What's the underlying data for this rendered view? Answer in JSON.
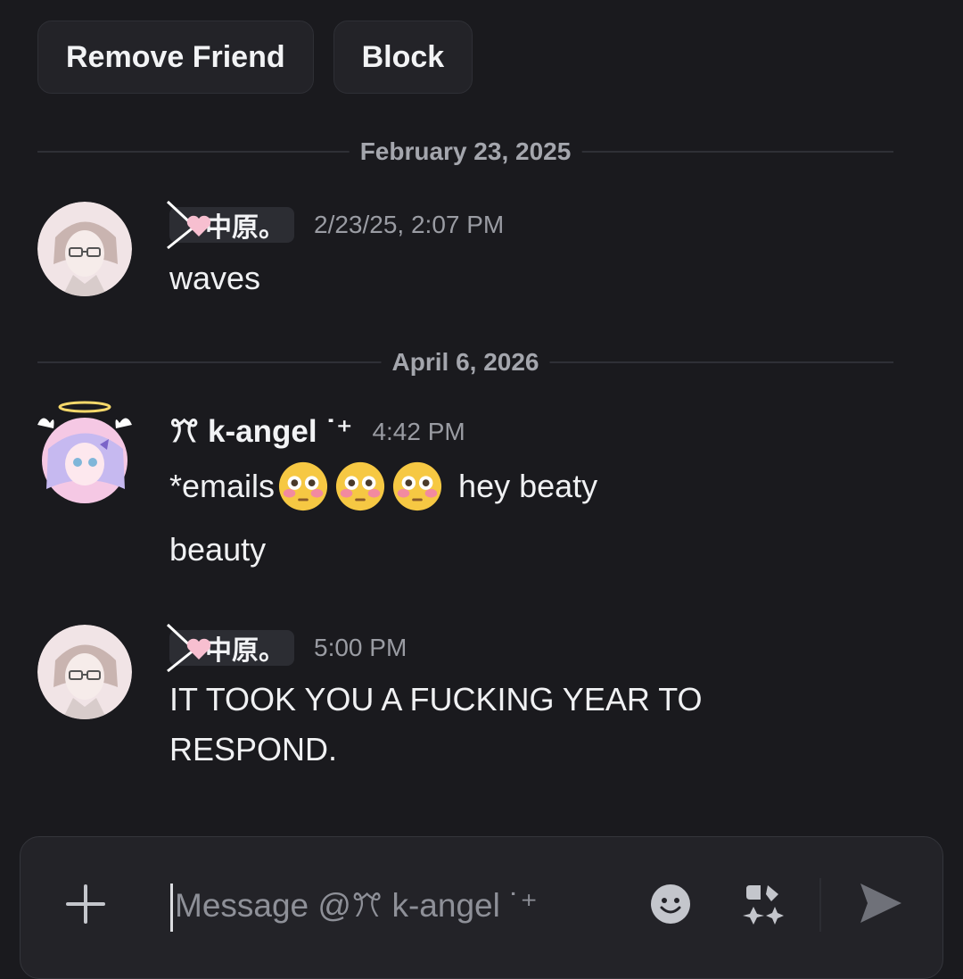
{
  "actions": {
    "remove_friend": "Remove Friend",
    "block": "Block"
  },
  "dividers": [
    "February 23, 2025",
    "April 6, 2026"
  ],
  "messages": [
    {
      "author": "中原。",
      "timestamp": "2/23/25, 2:07 PM",
      "lines": [
        "waves"
      ]
    },
    {
      "author": "ꔫ k-angel ˙⁺",
      "timestamp": "4:42 PM",
      "line1_prefix": "*emails",
      "line1_suffix": "hey beaty",
      "line2": "beauty"
    },
    {
      "author": "中原。",
      "timestamp": "5:00 PM",
      "lines": [
        "IT TOOK YOU A FUCKING YEAR TO",
        "RESPOND."
      ]
    }
  ],
  "composer": {
    "placeholder": "Message @ꔫ k-angel ˙⁺"
  },
  "icons": [
    "plus-icon",
    "emoji-icon",
    "apps-icon",
    "send-icon"
  ],
  "colors": {
    "background": "#1a1a1e",
    "surface": "#232328",
    "text": "#f2f3f5",
    "muted": "#9a9ca3"
  }
}
